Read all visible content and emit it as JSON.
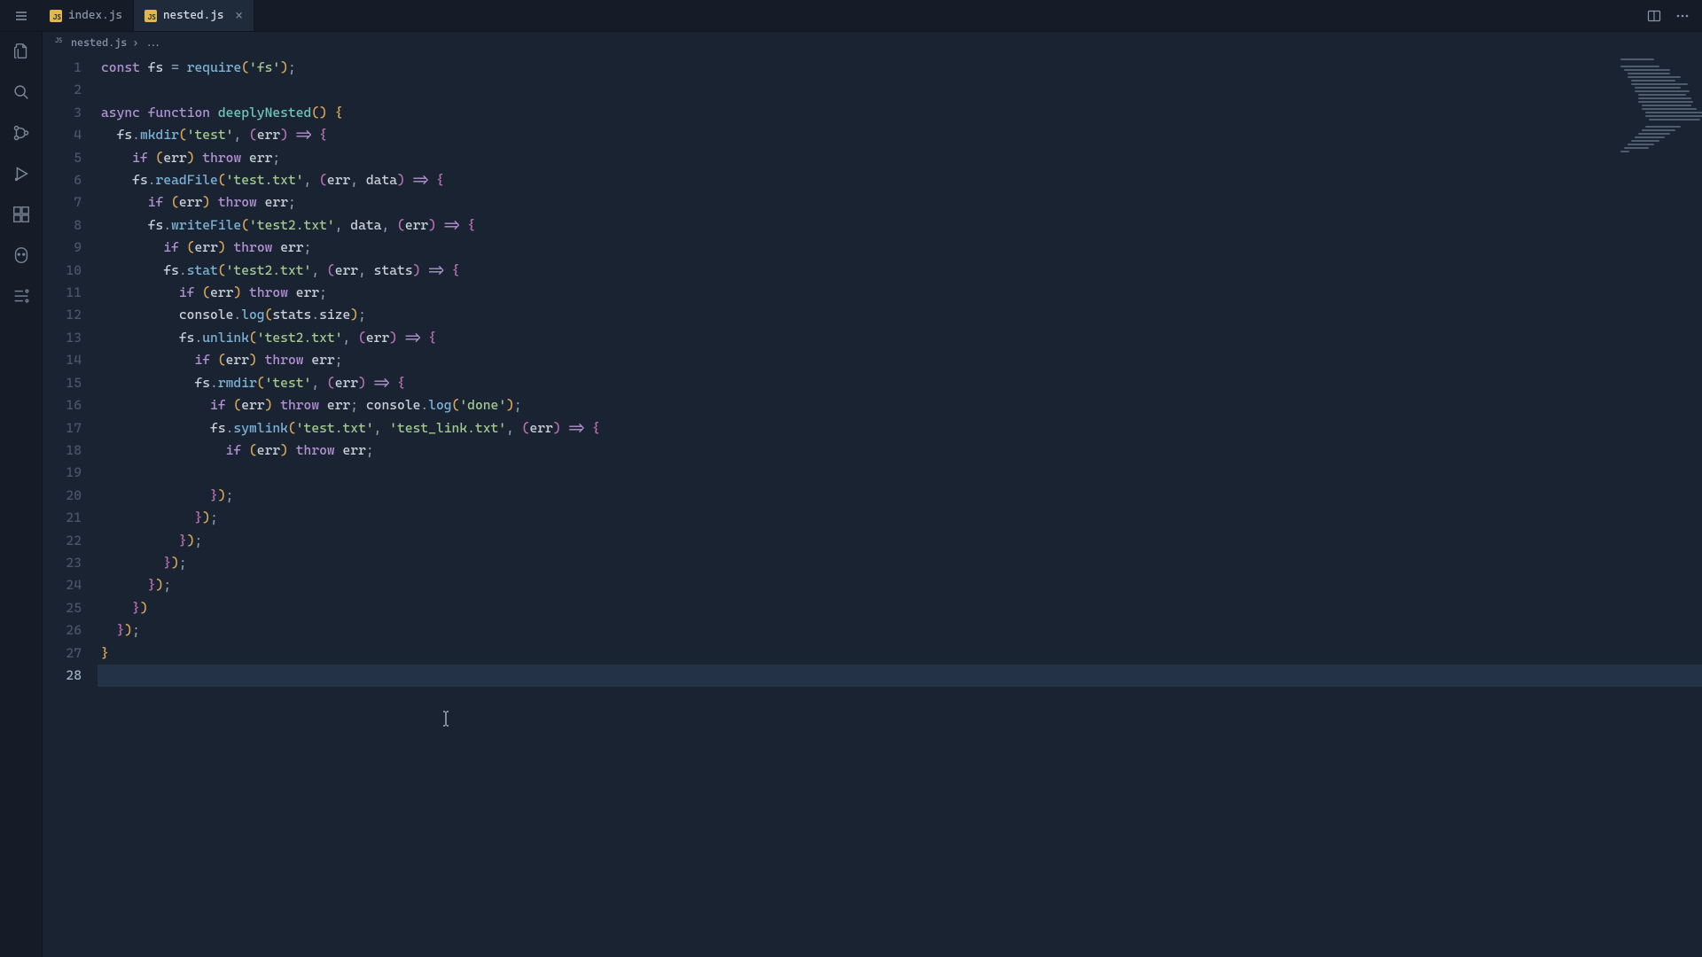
{
  "tabs": [
    {
      "label": "index.js"
    },
    {
      "label": "nested.js"
    }
  ],
  "active_tab": 1,
  "breadcrumb": {
    "file": "nested.js",
    "sep": "›",
    "ext": "..."
  },
  "line_count": 28,
  "current_line": 28,
  "code_lines": [
    [
      [
        "kw",
        "const"
      ],
      [
        "id",
        " fs "
      ],
      [
        "op",
        "="
      ],
      [
        "id",
        " "
      ],
      [
        "fn",
        "require"
      ],
      [
        "par",
        "("
      ],
      [
        "str",
        "'fs'"
      ],
      [
        "par",
        ")"
      ],
      [
        "op",
        ";"
      ]
    ],
    [],
    [
      [
        "kw",
        "async"
      ],
      [
        "id",
        " "
      ],
      [
        "kw",
        "function"
      ],
      [
        "id",
        " "
      ],
      [
        "decl",
        "deeplyNested"
      ],
      [
        "par",
        "()"
      ],
      [
        "id",
        " "
      ],
      [
        "par",
        "{"
      ]
    ],
    [
      [
        "id",
        "  fs"
      ],
      [
        "op",
        "."
      ],
      [
        "fn",
        "mkdir"
      ],
      [
        "par",
        "("
      ],
      [
        "str",
        "'test'"
      ],
      [
        "op",
        ","
      ],
      [
        "id",
        " "
      ],
      [
        "par2",
        "("
      ],
      [
        "id",
        "err"
      ],
      [
        "par2",
        ")"
      ],
      [
        "id",
        " "
      ],
      [
        "kw",
        "=>"
      ],
      [
        "id",
        " "
      ],
      [
        "par2",
        "{"
      ]
    ],
    [
      [
        "id",
        "    "
      ],
      [
        "kw",
        "if"
      ],
      [
        "id",
        " "
      ],
      [
        "par",
        "("
      ],
      [
        "id",
        "err"
      ],
      [
        "par",
        ")"
      ],
      [
        "id",
        " "
      ],
      [
        "kw",
        "throw"
      ],
      [
        "id",
        " err"
      ],
      [
        "op",
        ";"
      ]
    ],
    [
      [
        "id",
        "    fs"
      ],
      [
        "op",
        "."
      ],
      [
        "fn",
        "readFile"
      ],
      [
        "par",
        "("
      ],
      [
        "str",
        "'test.txt'"
      ],
      [
        "op",
        ","
      ],
      [
        "id",
        " "
      ],
      [
        "par2",
        "("
      ],
      [
        "id",
        "err"
      ],
      [
        "op",
        ","
      ],
      [
        "id",
        " data"
      ],
      [
        "par2",
        ")"
      ],
      [
        "id",
        " "
      ],
      [
        "kw",
        "=>"
      ],
      [
        "id",
        " "
      ],
      [
        "par2",
        "{"
      ]
    ],
    [
      [
        "id",
        "      "
      ],
      [
        "kw",
        "if"
      ],
      [
        "id",
        " "
      ],
      [
        "par",
        "("
      ],
      [
        "id",
        "err"
      ],
      [
        "par",
        ")"
      ],
      [
        "id",
        " "
      ],
      [
        "kw",
        "throw"
      ],
      [
        "id",
        " err"
      ],
      [
        "op",
        ";"
      ]
    ],
    [
      [
        "id",
        "      fs"
      ],
      [
        "op",
        "."
      ],
      [
        "fn",
        "writeFile"
      ],
      [
        "par",
        "("
      ],
      [
        "str",
        "'test2.txt'"
      ],
      [
        "op",
        ","
      ],
      [
        "id",
        " data"
      ],
      [
        "op",
        ","
      ],
      [
        "id",
        " "
      ],
      [
        "par2",
        "("
      ],
      [
        "id",
        "err"
      ],
      [
        "par2",
        ")"
      ],
      [
        "id",
        " "
      ],
      [
        "kw",
        "=>"
      ],
      [
        "id",
        " "
      ],
      [
        "par2",
        "{"
      ]
    ],
    [
      [
        "id",
        "        "
      ],
      [
        "kw",
        "if"
      ],
      [
        "id",
        " "
      ],
      [
        "par",
        "("
      ],
      [
        "id",
        "err"
      ],
      [
        "par",
        ")"
      ],
      [
        "id",
        " "
      ],
      [
        "kw",
        "throw"
      ],
      [
        "id",
        " err"
      ],
      [
        "op",
        ";"
      ]
    ],
    [
      [
        "id",
        "        fs"
      ],
      [
        "op",
        "."
      ],
      [
        "fn",
        "stat"
      ],
      [
        "par",
        "("
      ],
      [
        "str",
        "'test2.txt'"
      ],
      [
        "op",
        ","
      ],
      [
        "id",
        " "
      ],
      [
        "par2",
        "("
      ],
      [
        "id",
        "err"
      ],
      [
        "op",
        ","
      ],
      [
        "id",
        " stats"
      ],
      [
        "par2",
        ")"
      ],
      [
        "id",
        " "
      ],
      [
        "kw",
        "=>"
      ],
      [
        "id",
        " "
      ],
      [
        "par2",
        "{"
      ]
    ],
    [
      [
        "id",
        "          "
      ],
      [
        "kw",
        "if"
      ],
      [
        "id",
        " "
      ],
      [
        "par",
        "("
      ],
      [
        "id",
        "err"
      ],
      [
        "par",
        ")"
      ],
      [
        "id",
        " "
      ],
      [
        "kw",
        "throw"
      ],
      [
        "id",
        " err"
      ],
      [
        "op",
        ";"
      ]
    ],
    [
      [
        "id",
        "          console"
      ],
      [
        "op",
        "."
      ],
      [
        "fn",
        "log"
      ],
      [
        "par",
        "("
      ],
      [
        "id",
        "stats"
      ],
      [
        "op",
        "."
      ],
      [
        "id",
        "size"
      ],
      [
        "par",
        ")"
      ],
      [
        "op",
        ";"
      ]
    ],
    [
      [
        "id",
        "          fs"
      ],
      [
        "op",
        "."
      ],
      [
        "fn",
        "unlink"
      ],
      [
        "par",
        "("
      ],
      [
        "str",
        "'test2.txt'"
      ],
      [
        "op",
        ","
      ],
      [
        "id",
        " "
      ],
      [
        "par2",
        "("
      ],
      [
        "id",
        "err"
      ],
      [
        "par2",
        ")"
      ],
      [
        "id",
        " "
      ],
      [
        "kw",
        "=>"
      ],
      [
        "id",
        " "
      ],
      [
        "par2",
        "{"
      ]
    ],
    [
      [
        "id",
        "            "
      ],
      [
        "kw",
        "if"
      ],
      [
        "id",
        " "
      ],
      [
        "par",
        "("
      ],
      [
        "id",
        "err"
      ],
      [
        "par",
        ")"
      ],
      [
        "id",
        " "
      ],
      [
        "kw",
        "throw"
      ],
      [
        "id",
        " err"
      ],
      [
        "op",
        ";"
      ]
    ],
    [
      [
        "id",
        "            fs"
      ],
      [
        "op",
        "."
      ],
      [
        "fn",
        "rmdir"
      ],
      [
        "par",
        "("
      ],
      [
        "str",
        "'test'"
      ],
      [
        "op",
        ","
      ],
      [
        "id",
        " "
      ],
      [
        "par2",
        "("
      ],
      [
        "id",
        "err"
      ],
      [
        "par2",
        ")"
      ],
      [
        "id",
        " "
      ],
      [
        "kw",
        "=>"
      ],
      [
        "id",
        " "
      ],
      [
        "par2",
        "{"
      ]
    ],
    [
      [
        "id",
        "              "
      ],
      [
        "kw",
        "if"
      ],
      [
        "id",
        " "
      ],
      [
        "par",
        "("
      ],
      [
        "id",
        "err"
      ],
      [
        "par",
        ")"
      ],
      [
        "id",
        " "
      ],
      [
        "kw",
        "throw"
      ],
      [
        "id",
        " err"
      ],
      [
        "op",
        ";"
      ],
      [
        "id",
        " console"
      ],
      [
        "op",
        "."
      ],
      [
        "fn",
        "log"
      ],
      [
        "par",
        "("
      ],
      [
        "str",
        "'done'"
      ],
      [
        "par",
        ")"
      ],
      [
        "op",
        ";"
      ]
    ],
    [
      [
        "id",
        "              fs"
      ],
      [
        "op",
        "."
      ],
      [
        "fn",
        "symlink"
      ],
      [
        "par",
        "("
      ],
      [
        "str",
        "'test.txt'"
      ],
      [
        "op",
        ","
      ],
      [
        "id",
        " "
      ],
      [
        "str",
        "'test_link.txt'"
      ],
      [
        "op",
        ","
      ],
      [
        "id",
        " "
      ],
      [
        "par2",
        "("
      ],
      [
        "id",
        "err"
      ],
      [
        "par2",
        ")"
      ],
      [
        "id",
        " "
      ],
      [
        "kw",
        "=>"
      ],
      [
        "id",
        " "
      ],
      [
        "par2",
        "{"
      ]
    ],
    [
      [
        "id",
        "                "
      ],
      [
        "kw",
        "if"
      ],
      [
        "id",
        " "
      ],
      [
        "par",
        "("
      ],
      [
        "id",
        "err"
      ],
      [
        "par",
        ")"
      ],
      [
        "id",
        " "
      ],
      [
        "kw",
        "throw"
      ],
      [
        "id",
        " err"
      ],
      [
        "op",
        ";"
      ]
    ],
    [],
    [
      [
        "id",
        "              "
      ],
      [
        "par2",
        "}"
      ],
      [
        "par",
        ")"
      ],
      [
        "op",
        ";"
      ]
    ],
    [
      [
        "id",
        "            "
      ],
      [
        "par2",
        "}"
      ],
      [
        "par",
        ")"
      ],
      [
        "op",
        ";"
      ]
    ],
    [
      [
        "id",
        "          "
      ],
      [
        "par2",
        "}"
      ],
      [
        "par",
        ")"
      ],
      [
        "op",
        ";"
      ]
    ],
    [
      [
        "id",
        "        "
      ],
      [
        "par2",
        "}"
      ],
      [
        "par",
        ")"
      ],
      [
        "op",
        ";"
      ]
    ],
    [
      [
        "id",
        "      "
      ],
      [
        "par2",
        "}"
      ],
      [
        "par",
        ")"
      ],
      [
        "op",
        ";"
      ]
    ],
    [
      [
        "id",
        "    "
      ],
      [
        "par2",
        "}"
      ],
      [
        "par",
        ")"
      ]
    ],
    [
      [
        "id",
        "  "
      ],
      [
        "par2",
        "}"
      ],
      [
        "par",
        ")"
      ],
      [
        "op",
        ";"
      ]
    ],
    [
      [
        "par",
        "}"
      ]
    ],
    []
  ],
  "minimap_widths": [
    38,
    0,
    44,
    52,
    48,
    60,
    50,
    64,
    52,
    62,
    54,
    60,
    62,
    56,
    62,
    70,
    72,
    58,
    0,
    40,
    38,
    36,
    34,
    32,
    30,
    28,
    10,
    0
  ],
  "minimap_indents": [
    0,
    0,
    0,
    4,
    8,
    8,
    12,
    12,
    16,
    16,
    20,
    20,
    20,
    24,
    24,
    28,
    28,
    32,
    0,
    28,
    24,
    20,
    16,
    12,
    8,
    4,
    0,
    0
  ],
  "icons": {
    "js": "JS"
  }
}
